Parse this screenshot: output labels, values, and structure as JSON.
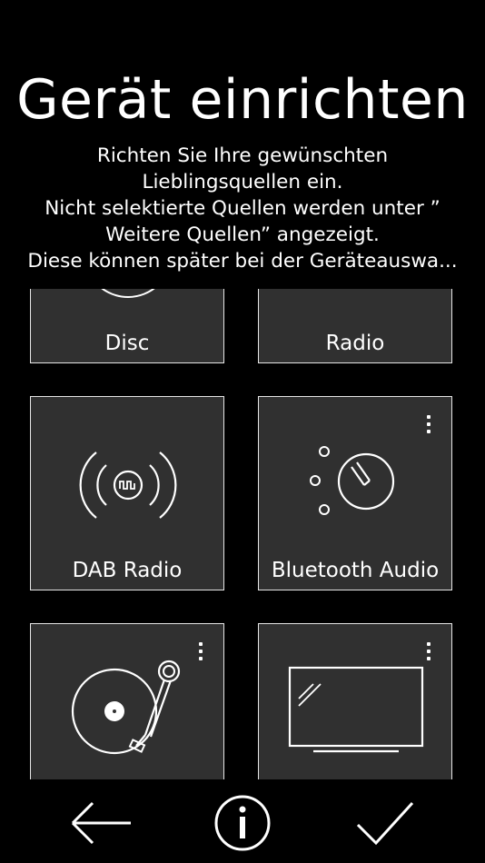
{
  "header": {
    "title": "Gerät einrichten",
    "description_lines": [
      "Richten Sie Ihre gewünschten",
      "Lieblingsquellen ein.",
      "Nicht selektierte Quellen werden unter ”",
      "Weitere Quellen” angezeigt.",
      "Diese können später bei der Geräteauswa..."
    ]
  },
  "sources": [
    {
      "label": "Disc",
      "icon": "disc-icon",
      "has_menu": false
    },
    {
      "label": "Radio",
      "icon": "radio-icon",
      "has_menu": false
    },
    {
      "label": "DAB Radio",
      "icon": "dab-radio-icon",
      "has_menu": false
    },
    {
      "label": "Bluetooth Audio",
      "icon": "bluetooth-audio-icon",
      "has_menu": true
    },
    {
      "label": "",
      "icon": "turntable-icon",
      "has_menu": true
    },
    {
      "label": "",
      "icon": "tv-icon",
      "has_menu": true
    }
  ],
  "footer": {
    "back_icon": "arrow-left-icon",
    "info_icon": "info-icon",
    "confirm_icon": "checkmark-icon"
  },
  "colors": {
    "background": "#000000",
    "tile": "#303030",
    "tile_border": "#e6e6e6",
    "text": "#ffffff"
  }
}
